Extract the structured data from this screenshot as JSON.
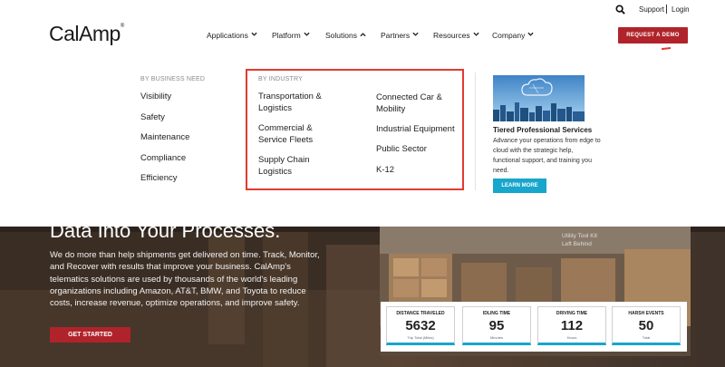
{
  "header": {
    "logo_text": "CalAmp",
    "logo_mark": "®",
    "support_label": "Support",
    "login_label": "Login",
    "cta_label": "REQUEST A DEMO",
    "nav": [
      {
        "label": "Applications",
        "chevron": "down"
      },
      {
        "label": "Platform",
        "chevron": "down"
      },
      {
        "label": "Solutions",
        "chevron": "up"
      },
      {
        "label": "Partners",
        "chevron": "down"
      },
      {
        "label": "Resources",
        "chevron": "down"
      },
      {
        "label": "Company",
        "chevron": "down"
      }
    ]
  },
  "mega_menu": {
    "business_need": {
      "heading": "BY BUSINESS NEED",
      "items": [
        "Visibility",
        "Safety",
        "Maintenance",
        "Compliance",
        "Efficiency"
      ]
    },
    "industry": {
      "heading": "BY INDUSTRY",
      "left": [
        "Transportation &\nLogistics",
        "Commercial &\nService Fleets",
        "Supply Chain\nLogistics"
      ],
      "right": [
        "Connected Car &\nMobility",
        "Industrial Equipment",
        "Public Sector",
        "K-12"
      ]
    },
    "promo": {
      "title": "Tiered Professional Services",
      "text": "Advance your operations from edge to cloud with the strategic help, functional support, and training you need.",
      "button_label": "LEARN MORE"
    }
  },
  "hero": {
    "headline": "Data Into Your Processes.",
    "body": "We do more than help shipments get delivered on time. Track, Monitor, and Recover with results that improve your business. CalAmp's telematics solutions are used by thousands of the world's leading organizations including Amazon, AT&T, BMW, and Toyota to reduce costs, increase revenue, optimize operations, and improve safety.",
    "button_label": "GET STARTED",
    "overlay_text": "Utility Tool Kit\nLeft Behind",
    "stats": [
      {
        "label": "DISTANCE TRAVELED",
        "value": "5632",
        "unit": "Trip Total (Miles)"
      },
      {
        "label": "IDLING TIME",
        "value": "95",
        "unit": "Minutes"
      },
      {
        "label": "DRIVING TIME",
        "value": "112",
        "unit": "Hours"
      },
      {
        "label": "HARSH EVENTS",
        "value": "50",
        "unit": "Total"
      }
    ]
  },
  "colors": {
    "brand_red": "#b0232a",
    "accent_blue": "#17a6cc",
    "highlight": "#e23a2f"
  }
}
